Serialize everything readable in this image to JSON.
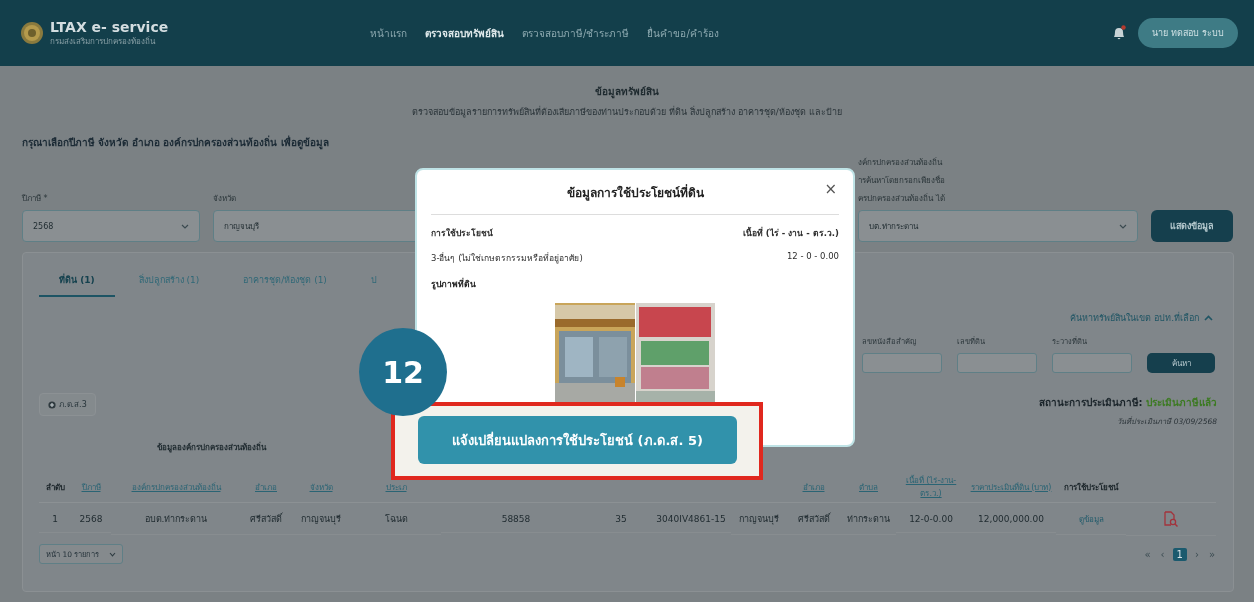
{
  "header": {
    "app_name": "LTAX e- service",
    "subtitle": "กรมส่งเสริมการปกครองท้องถิ่น",
    "nav": [
      {
        "label": "หน้าแรก",
        "selected": false
      },
      {
        "label": "ตรวจสอบทรัพย์สิน",
        "selected": true
      },
      {
        "label": "ตรวจสอบภาษี/ชำระภาษี",
        "selected": false
      },
      {
        "label": "ยื่นคำขอ/คำร้อง",
        "selected": false
      }
    ],
    "notification": true,
    "user_button": "นาย ทดสอบ ระบบ"
  },
  "page": {
    "title": "ข้อมูลทรัพย์สิน",
    "subtitle": "ตรวจสอบข้อมูลรายการทรัพย์สินที่ต้องเสียภาษีของท่านประกอบด้วย ที่ดิน สิ่งปลูกสร้าง อาคารชุด/ห้องชุด และป้าย",
    "instruction": "กรุณาเลือกปีภาษี จังหวัด อำเภอ องค์กรปกครองส่วนท้องถิ่น เพื่อดูข้อมูล"
  },
  "filters": {
    "fields": [
      {
        "label": [
          "ปีภาษี *"
        ],
        "value": "2568"
      },
      {
        "label": [
          "จังหวัด"
        ],
        "value": "กาญจนบุรี"
      },
      {
        "label": [
          "งค์กรปกครองส่วนท้องถิ่น",
          "ารค้นหาโดยกรอกเพียงชื่อ",
          "ครปกครองส่วนท้องถิ่น ได้"
        ],
        "value": "บต.ท่ากระดาน"
      }
    ],
    "submit": "แสดงข้อมูล"
  },
  "tabs": [
    {
      "label": "ที่ดิน (1)",
      "selected": true
    },
    {
      "label": "สิ่งปลูกสร้าง (1)",
      "selected": false
    },
    {
      "label": "อาคารชุด/ห้องชุด (1)",
      "selected": false
    },
    {
      "label": "ป",
      "selected": false
    }
  ],
  "search": {
    "toggle": "ค้นหาทรัพย์สินในเขต อปท.ที่เลือก",
    "expanded": true,
    "fields": [
      "ลขหนังสือสำคัญ",
      "เลขที่ดิน",
      "ระวางที่ดิน"
    ],
    "button": "ค้นหา"
  },
  "report_button": "ภ.ด.ส.3",
  "status": {
    "label": "สถานะการประเมินภาษี:",
    "value": "ประเมินภาษีแล้ว",
    "date": "วันที่ประเมินภาษี 03/09/2568"
  },
  "table": {
    "group_header": "ข้อมูลองค์กรปกครองส่วนท้องถิ่น",
    "columns": [
      {
        "label": "ลำดับ",
        "sortable": false
      },
      {
        "label": "ปีภาษี",
        "sortable": true
      },
      {
        "label": "องค์กรปกครองส่วนท้องถิ่น",
        "sortable": true
      },
      {
        "label": "อำเภอ",
        "sortable": true
      },
      {
        "label": "จังหวัด",
        "sortable": true
      },
      {
        "label": "ประเภ",
        "sortable": true
      },
      null,
      null,
      null,
      null,
      {
        "label": "อำเภอ",
        "sortable": true
      },
      {
        "label": "ตำบล",
        "sortable": true
      },
      {
        "label": "เนื้อที่ (ไร่-งาน-ตร.ว.)",
        "sortable": true
      },
      {
        "label": "ราคาประเมินที่ดิน (บาท)",
        "sortable": true
      },
      {
        "label": "การใช้ประโยชน์",
        "sortable": false
      },
      null
    ],
    "rows": [
      [
        {
          "kind": "text",
          "text": "1"
        },
        {
          "kind": "text",
          "text": "2568"
        },
        {
          "kind": "text",
          "text": "อบต.ท่ากระดาน"
        },
        {
          "kind": "text",
          "text": "ศรีสวัสดิ์"
        },
        {
          "kind": "text",
          "text": "กาญจนบุรี"
        },
        {
          "kind": "text",
          "text": "โฉนด"
        },
        {
          "kind": "text",
          "text": "58858"
        },
        {
          "kind": "text",
          "text": "35"
        },
        {
          "kind": "text",
          "text": "3040IV4861-15"
        },
        {
          "kind": "text",
          "text": "กาญจนบุรี"
        },
        {
          "kind": "text",
          "text": "ศรีสวัสดิ์"
        },
        {
          "kind": "text",
          "text": "ท่ากระดาน"
        },
        {
          "kind": "text",
          "text": "12-0-0.00"
        },
        {
          "kind": "text",
          "text": "12,000,000.00"
        },
        {
          "kind": "link",
          "text": "ดูข้อมูล"
        },
        {
          "kind": "icon"
        }
      ]
    ]
  },
  "page_size": "หน้า 10 รายการ",
  "pagination": {
    "first": "«",
    "prev": "‹",
    "pages": [
      {
        "label": "1",
        "selected": true
      }
    ],
    "next": "›",
    "last": "»"
  },
  "modal": {
    "title": "ข้อมูลการใช้ประโยชน์ที่ดิน",
    "close": "×",
    "columns": [
      "การใช้ประโยชน์",
      "เนื้อที่ (ไร่ - งาน - ตร.ว.)"
    ],
    "rows": [
      {
        "usage": "3-อื่นๆ (ไม่ใช่เกษตรกรรมหรือที่อยู่อาศัย)",
        "area": "12 - 0 - 0.00"
      }
    ],
    "photo_label": "รูปภาพที่ดิน",
    "action": "แจ้งเปลี่ยนแปลงการใช้ประโยชน์ (ภ.ด.ส. 5)"
  },
  "callout": {
    "step": "12",
    "highlight": true
  }
}
